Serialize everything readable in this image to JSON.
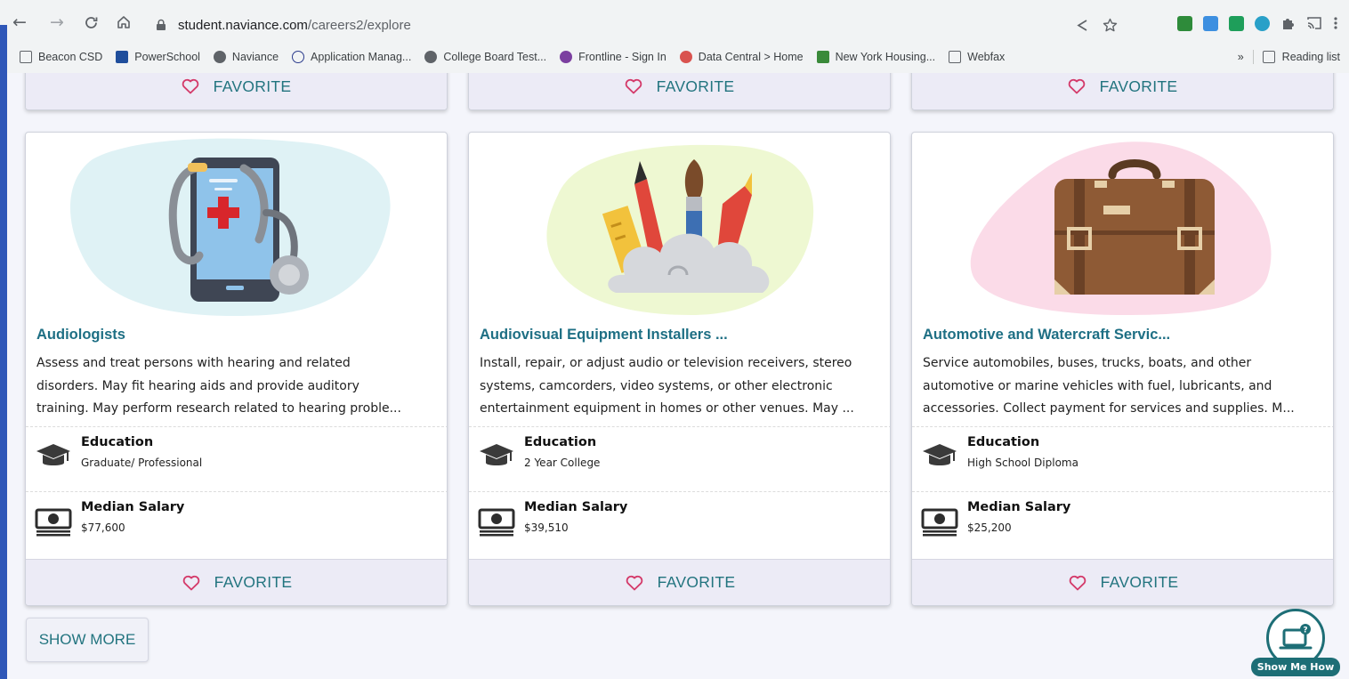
{
  "browser": {
    "url_host": "student.naviance.com",
    "url_path": "/careers2/explore",
    "bookmarks": [
      {
        "label": "Beacon CSD",
        "icon": "folder-icon",
        "color": "#5f6368"
      },
      {
        "label": "PowerSchool",
        "icon": "sis-icon",
        "color": "#1f4e9c"
      },
      {
        "label": "Naviance",
        "icon": "globe-icon",
        "color": "#5f6368"
      },
      {
        "label": "Application Manag...",
        "icon": "suny-icon",
        "color": "#2b3b8c"
      },
      {
        "label": "College Board Test...",
        "icon": "globe-icon",
        "color": "#5f6368"
      },
      {
        "label": "Frontline - Sign In",
        "icon": "frontline-icon",
        "color": "#7b3fa0"
      },
      {
        "label": "Data Central > Home",
        "icon": "data-central-icon",
        "color": "#d9534f"
      },
      {
        "label": "New York Housing...",
        "icon": "housing-icon",
        "color": "#3a8a3a"
      },
      {
        "label": "Webfax",
        "icon": "webfax-icon",
        "color": "#5f6368"
      }
    ],
    "more_bookmarks": "»",
    "reading_list": "Reading list"
  },
  "favorite_label": "FAVORITE",
  "cards": [
    {
      "title": "Audiologists",
      "desc_lines": [
        "Assess and treat persons with hearing and related",
        "disorders. May fit hearing aids and provide auditory",
        "training. May perform research related to hearing proble..."
      ],
      "education_label": "Education",
      "education_value": "Graduate/ Professional",
      "salary_label": "Median Salary",
      "salary_value": "$77,600",
      "art": "stethoscope-phone-illustration",
      "blob_color": "#dff2f5"
    },
    {
      "title": "Audiovisual Equipment Installers ...",
      "desc_lines": [
        "Install, repair, or adjust audio or television receivers, stereo",
        "systems, camcorders, video systems, or other electronic",
        "entertainment equipment in homes or other venues. May ..."
      ],
      "education_label": "Education",
      "education_value": "2 Year College",
      "salary_label": "Median Salary",
      "salary_value": "$39,510",
      "art": "art-supplies-illustration",
      "blob_color": "#eef8d2"
    },
    {
      "title": "Automotive and Watercraft Servic...",
      "desc_lines": [
        "Service automobiles, buses, trucks, boats, and other",
        "automotive or marine vehicles with fuel, lubricants, and",
        "accessories. Collect payment for services and supplies. M..."
      ],
      "education_label": "Education",
      "education_value": "High School Diploma",
      "salary_label": "Median Salary",
      "salary_value": "$25,200",
      "art": "briefcase-illustration",
      "blob_color": "#fbdbe8"
    }
  ],
  "show_more_label": "SHOW MORE",
  "show_me_how_label": "Show Me How",
  "colors": {
    "accent_teal": "#22747f",
    "title_teal": "#1e6f84",
    "heart_pink": "#d43a6a",
    "favorite_bar": "#ecebf6"
  }
}
